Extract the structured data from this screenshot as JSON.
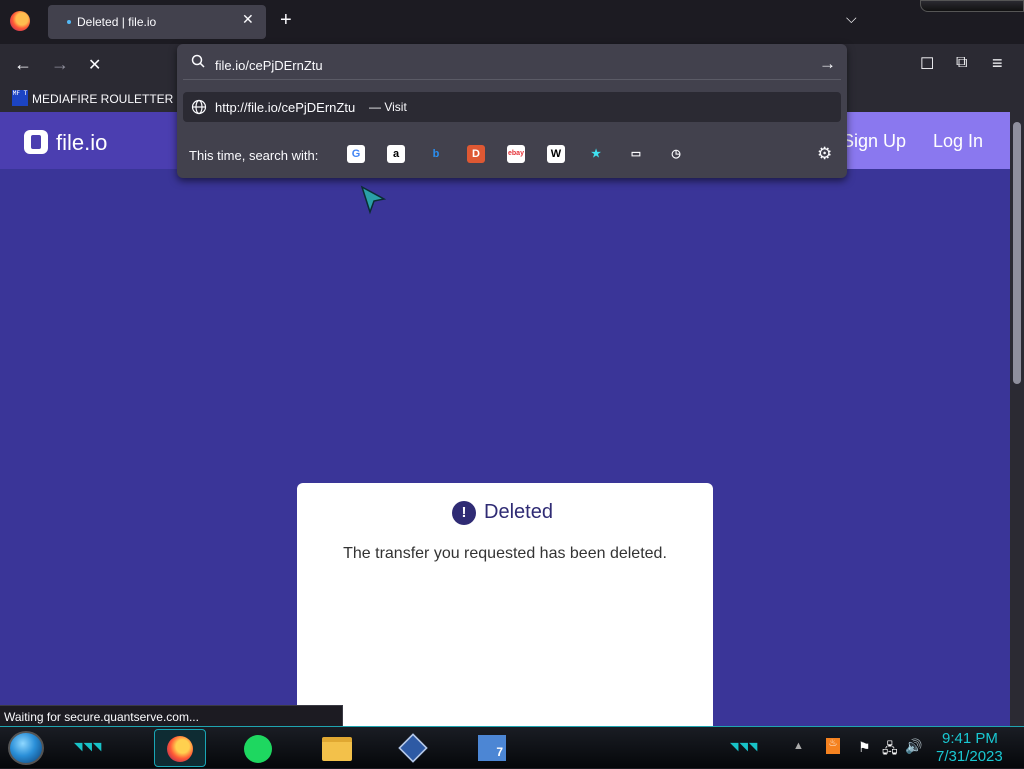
{
  "browser": {
    "tab_title": "Deleted | file.io",
    "tab_close": "✕",
    "new_tab": "+",
    "tab_list": "⌵",
    "back": "←",
    "forward": "→",
    "stop": "✕",
    "pocket": "☐",
    "extensions": "⧉",
    "menu": "≡"
  },
  "bookmarks": {
    "items": [
      {
        "icon_text": "MF T",
        "label": "MEDIAFIRE ROULETTER"
      }
    ]
  },
  "urlbar": {
    "value": "file.io/cePjDErnZtu",
    "go": "→",
    "suggestion_url": "http://file.io/cePjDErnZtu",
    "suggestion_action": "— Visit",
    "oneoff_label": "This time, search with:",
    "engines": [
      {
        "name": "google-icon",
        "glyph": "G",
        "bg": "#ffffff",
        "fg": "#4285f4"
      },
      {
        "name": "amazon-icon",
        "glyph": "a",
        "bg": "#ffffff",
        "fg": "#000000"
      },
      {
        "name": "bing-icon",
        "glyph": "b",
        "bg": "transparent",
        "fg": "#2a8ef0"
      },
      {
        "name": "duckduckgo-icon",
        "glyph": "D",
        "bg": "#de5833",
        "fg": "#ffffff"
      },
      {
        "name": "ebay-icon",
        "glyph": "ebay",
        "bg": "#ffffff",
        "fg": "#e53238"
      },
      {
        "name": "wikipedia-icon",
        "glyph": "W",
        "bg": "#ffffff",
        "fg": "#000000"
      },
      {
        "name": "bookmarks-star-icon",
        "glyph": "★",
        "bg": "transparent",
        "fg": "#3fe1f0"
      },
      {
        "name": "tabs-icon",
        "glyph": "▭",
        "bg": "transparent",
        "fg": "#fbfbfe"
      },
      {
        "name": "history-icon",
        "glyph": "◷",
        "bg": "transparent",
        "fg": "#fbfbfe"
      }
    ],
    "settings": "⚙"
  },
  "site": {
    "logo_text": "file.io",
    "signup": "Sign Up",
    "login": "Log In",
    "card_icon": "!",
    "card_title": "Deleted",
    "card_message": "The transfer you requested has been deleted."
  },
  "status": {
    "text": "Waiting for secure.quantserve.com..."
  },
  "taskbar": {
    "zip_label": "7",
    "tray_java": "♨",
    "tray_flag": "⚑",
    "tray_network": "🖧",
    "tray_volume": "🔊",
    "tray_up": "▲",
    "time": "9:41 PM",
    "date": "7/31/2023",
    "colors": {
      "accent": "#19c8d2"
    }
  },
  "colors": {
    "page_bg": "#3a3598",
    "header_bg": "#4b3eb0",
    "header_right_bg": "#8a78ef",
    "card_bg": "#ffffff",
    "card_title": "#2f2b74"
  }
}
